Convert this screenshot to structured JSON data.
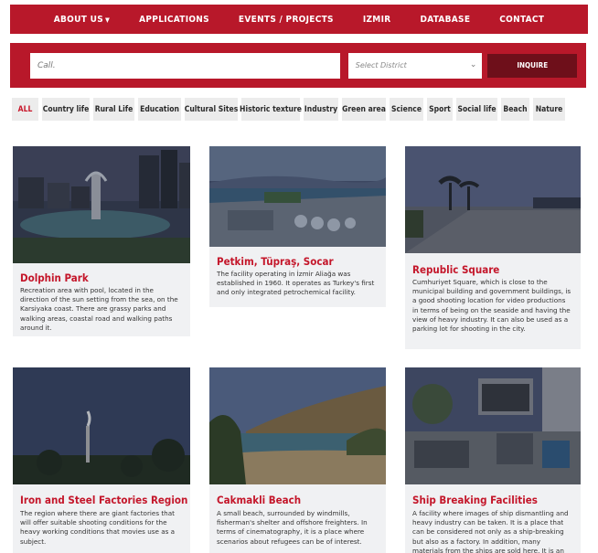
{
  "nav": {
    "about": "ABOUT US",
    "applications": "APPLICATIONS",
    "events": "EVENTS / PROJECTS",
    "izmir": "IZMIR",
    "database": "DATABASE",
    "contact": "CONTACT"
  },
  "search": {
    "call_placeholder": "Call.",
    "district_placeholder": "Select District",
    "inquire_label": "INQUIRE"
  },
  "filters": [
    "ALL",
    "Country life",
    "Rural Life",
    "Education",
    "Cultural Sites",
    "Historic texture",
    "Industry",
    "Green area",
    "Science",
    "Sport",
    "Social life",
    "Beach",
    "Nature"
  ],
  "colors": {
    "brand_red": "#b8182a",
    "button_dark": "#6e0f1a",
    "title_red": "#c4162a",
    "card_bg": "#f0f1f3"
  },
  "cards": [
    {
      "title": "Dolphin Park",
      "description": "Recreation area with pool, located in the direction of the sun setting from the sea, on the Karsiyaka coast. There are grassy parks and walking areas, coastal road and walking paths around it."
    },
    {
      "title": "Petkim, Tüpraş, Socar",
      "description": "The facility operating in İzmir Aliağa was established in 1960. It operates as Turkey's first and only integrated petrochemical facility."
    },
    {
      "title": "Republic Square",
      "description": "Cumhuriyet Square, which is close to the municipal building and government buildings, is a good shooting location for video productions in terms of being on the seaside and having the view of heavy industry. It can also be used as a parking lot for shooting in the city."
    },
    {
      "title": "Iron and Steel Factories Region",
      "description": "The region where there are giant factories that will offer suitable shooting conditions for the heavy working conditions that movies use as a subject."
    },
    {
      "title": "Cakmakli Beach",
      "description": "A small beach, surrounded by windmills, fisherman's shelter and offshore freighters. In terms of cinematography, it is a place where scenarios about refugees can be of interest."
    },
    {
      "title": "Ship Breaking Facilities",
      "description": "A facility where images of ship dismantling and heavy industry can be taken. It is a place that can be considered not only as a ship-breaking but also as a factory. In addition, many materials from the ships are sold here. It is an area where various objects"
    }
  ]
}
